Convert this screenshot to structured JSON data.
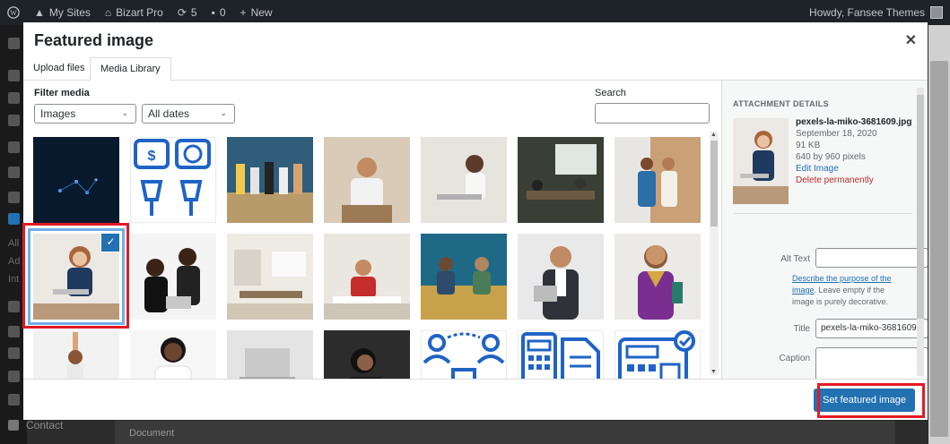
{
  "admin_bar": {
    "my_sites": "My Sites",
    "site_name": "Bizart Pro",
    "updates_count": "5",
    "comments_count": "0",
    "new_label": "New",
    "howdy": "Howdy, Fansee Themes"
  },
  "background": {
    "menu_fragments": [
      "All",
      "Ad",
      "Int"
    ],
    "contact": "Contact",
    "document": "Document"
  },
  "modal": {
    "title": "Featured image",
    "close_icon": "close-icon",
    "tabs": [
      {
        "label": "Upload files",
        "active": false
      },
      {
        "label": "Media Library",
        "active": true
      }
    ],
    "filter_label": "Filter media",
    "type_filter": "Images",
    "date_filter": "All dates",
    "search_label": "Search",
    "search_value": ""
  },
  "grid": {
    "thumbnails": [
      {
        "name": "dark network cubes",
        "selected": false
      },
      {
        "name": "price and glasses icons",
        "selected": false
      },
      {
        "name": "team sitting in office",
        "selected": false
      },
      {
        "name": "man with laptop smiling",
        "selected": false
      },
      {
        "name": "woman working on laptop",
        "selected": false
      },
      {
        "name": "presentation meeting room",
        "selected": false
      },
      {
        "name": "two people walking in office",
        "selected": false
      },
      {
        "name": "woman with laptop",
        "selected": true
      },
      {
        "name": "two women at laptop",
        "selected": false
      },
      {
        "name": "office interior",
        "selected": false
      },
      {
        "name": "woman in red at desk",
        "selected": false
      },
      {
        "name": "two men on sofa",
        "selected": false
      },
      {
        "name": "man in suit with tablet",
        "selected": false
      },
      {
        "name": "woman with folder",
        "selected": false
      },
      {
        "name": "person stretching",
        "selected": false
      },
      {
        "name": "smiling woman",
        "selected": false
      },
      {
        "name": "laptop on desk",
        "selected": false
      },
      {
        "name": "woman on phone",
        "selected": false
      },
      {
        "name": "team network icon",
        "selected": false
      },
      {
        "name": "calculator and document icon",
        "selected": false
      },
      {
        "name": "fax machine icon",
        "selected": false
      }
    ]
  },
  "attachment": {
    "heading": "ATTACHMENT DETAILS",
    "filename": "pexels-la-miko-3681609.jpg",
    "date": "September 18, 2020",
    "size": "91 KB",
    "dimensions": "640 by 960 pixels",
    "edit_link": "Edit Image",
    "delete_link": "Delete permanently",
    "alt_label": "Alt Text",
    "alt_value": "",
    "alt_help_link": "Describe the purpose of the image",
    "alt_help_rest": ". Leave empty if the image is purely decorative.",
    "title_label": "Title",
    "title_value": "pexels-la-miko-3681609",
    "caption_label": "Caption",
    "caption_value": ""
  },
  "toolbar": {
    "set_button": "Set featured image"
  },
  "colors": {
    "primary": "#2271b1",
    "highlight": "#e01b24",
    "icon_blue": "#1f63c6"
  }
}
